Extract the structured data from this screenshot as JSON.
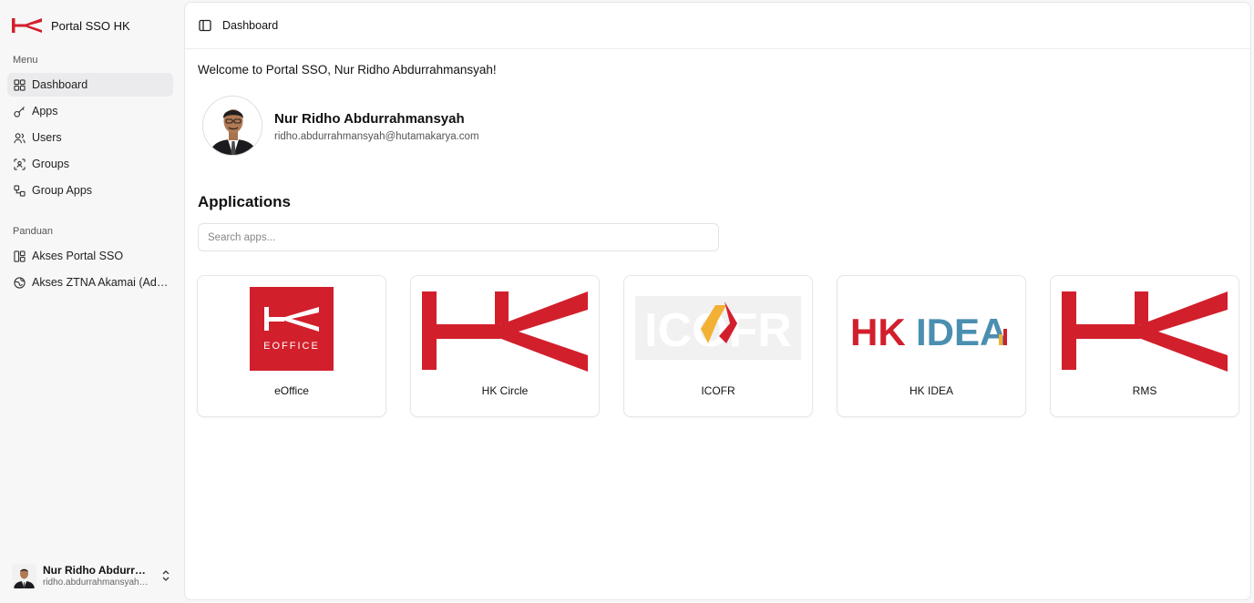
{
  "sidebar": {
    "brand_title": "Portal SSO HK",
    "menu_label": "Menu",
    "menu_items": [
      {
        "label": "Dashboard",
        "icon": "grid-icon"
      },
      {
        "label": "Apps",
        "icon": "key-icon"
      },
      {
        "label": "Users",
        "icon": "users-icon"
      },
      {
        "label": "Groups",
        "icon": "scan-user-icon"
      },
      {
        "label": "Group Apps",
        "icon": "workflow-icon"
      }
    ],
    "guide_label": "Panduan",
    "guide_items": [
      {
        "label": "Akses Portal SSO",
        "icon": "layout-icon"
      },
      {
        "label": "Akses ZTNA Akamai (Advanced)",
        "icon": "globe-icon"
      }
    ],
    "user": {
      "name": "Nur Ridho Abdurrahmansyah",
      "email": "ridho.abdurrahmansyah@hutamakarya.com"
    }
  },
  "header": {
    "breadcrumb": "Dashboard"
  },
  "main": {
    "welcome": "Welcome to Portal SSO, Nur Ridho Abdurrahmansyah!",
    "profile": {
      "name": "Nur Ridho Abdurrahmansyah",
      "email": "ridho.abdurrahmansyah@hutamakarya.com"
    },
    "apps_title": "Applications",
    "search_placeholder": "Search apps...",
    "apps": [
      {
        "name": "eOffice",
        "logo_text": "EOFFICE"
      },
      {
        "name": "HK Circle"
      },
      {
        "name": "ICOFR",
        "logo_text": "ICOFR"
      },
      {
        "name": "HK IDEA",
        "logo_text_1": "HK",
        "logo_text_2": "IDEA"
      },
      {
        "name": "RMS"
      }
    ]
  },
  "colors": {
    "brand_red": "#d21f2c",
    "idea_blue": "#4a8fb0",
    "icofr_orange": "#f2b134",
    "active_nav_bg": "#ebebed"
  }
}
